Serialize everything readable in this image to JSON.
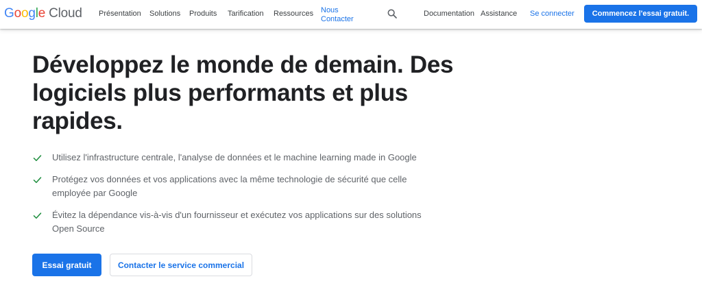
{
  "header": {
    "logo": {
      "google_letters": [
        "G",
        "o",
        "o",
        "g",
        "l",
        "e"
      ],
      "product": "Cloud",
      "colors": {
        "blue": "#4285f4",
        "red": "#ea4335",
        "yellow": "#fbbc04",
        "green": "#34a853"
      }
    },
    "nav": {
      "items": [
        "Présentation",
        "Solutions",
        "Produits",
        "Tarification",
        "Ressources"
      ],
      "contact": "Nous Contacter",
      "search_icon": "search-icon",
      "documentation": "Documentation",
      "assistance": "Assistance",
      "signin": "Se connecter",
      "cta": "Commencez l'essai gratuit."
    }
  },
  "hero": {
    "headline": "Développez le monde de demain. Des logiciels plus performants et plus rapides.",
    "features": [
      "Utilisez l'infrastructure centrale, l'analyse de données et le machine learning made in Google",
      "Protégez vos données et vos applications avec la même technologie de sécurité que celle employée par Google",
      "Évitez la dépendance vis-à-vis d'un fournisseur et exécutez vos applications sur des solutions Open Source"
    ],
    "check_icon": "check-icon",
    "buttons": {
      "primary": "Essai gratuit",
      "secondary": "Contacter le service commercial"
    }
  },
  "colors": {
    "accent": "#1a73e8",
    "check": "#1e8e3e",
    "text_primary": "#202124",
    "text_secondary": "#5f6368"
  }
}
